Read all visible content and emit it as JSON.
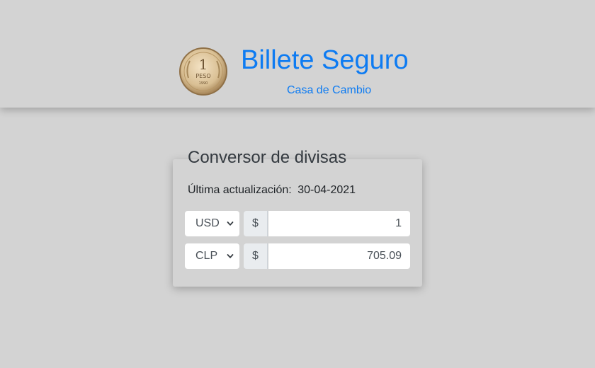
{
  "header": {
    "title": "Billete Seguro",
    "subtitle": "Casa de Cambio",
    "logo_icon": "peso-coin-icon",
    "accent_color": "#0d7bf2"
  },
  "converter": {
    "title": "Conversor de divisas",
    "updated_label": "Última actualización:",
    "updated_date": "30-04-2021",
    "rows": [
      {
        "currency": "USD",
        "symbol": "$",
        "amount": "1"
      },
      {
        "currency": "CLP",
        "symbol": "$",
        "amount": "705.09"
      }
    ]
  }
}
